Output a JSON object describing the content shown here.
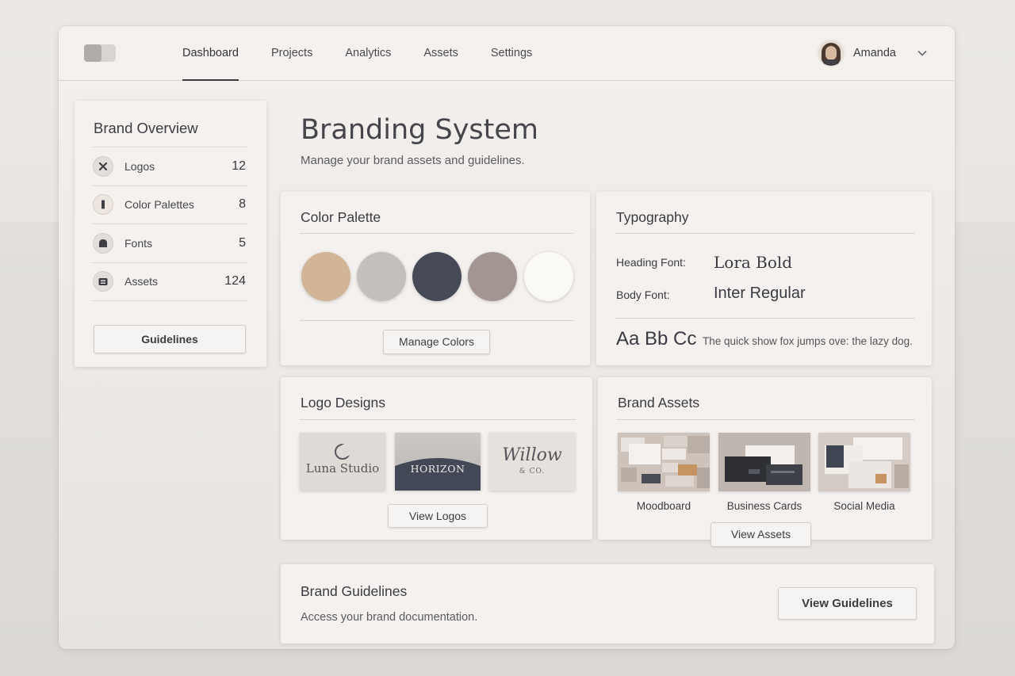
{
  "nav": {
    "tabs": [
      {
        "label": "Dashboard"
      },
      {
        "label": "Projects"
      },
      {
        "label": "Analytics"
      },
      {
        "label": "Assets"
      },
      {
        "label": "Settings"
      }
    ],
    "active_tab": "Dashboard",
    "user_name": "Amanda"
  },
  "sidebar": {
    "title": "Brand Overview",
    "items": [
      {
        "label": "Logos",
        "count": "12",
        "icon": "logo-icon"
      },
      {
        "label": "Color Palettes",
        "count": "8",
        "icon": "palette-icon"
      },
      {
        "label": "Fonts",
        "count": "5",
        "icon": "font-icon"
      },
      {
        "label": "Assets",
        "count": "124",
        "icon": "assets-icon"
      }
    ],
    "button_label": "Guidelines"
  },
  "page": {
    "title": "Branding System",
    "subtitle": "Manage your brand assets and guidelines."
  },
  "palette": {
    "title": "Color Palette",
    "colors": [
      "#d1b596",
      "#c5bfbc",
      "#464a56",
      "#a29592",
      "#fbf9f6"
    ],
    "button_label": "Manage Colors"
  },
  "typography": {
    "title": "Typography",
    "heading_label": "Heading Font:",
    "heading_value": "Lora Bold",
    "body_label": "Body Font:",
    "body_value": "Inter Regular",
    "sample_large": "Aa Bb Cc",
    "sample_text": "The quick show fox jumps ove: the lazy dog."
  },
  "logos": {
    "title": "Logo Designs",
    "items": [
      {
        "name": "Luna Studio"
      },
      {
        "name": "HORIZON"
      },
      {
        "name": "Willow",
        "sub": "& CO."
      }
    ],
    "button_label": "View Logos"
  },
  "assets": {
    "title": "Brand Assets",
    "items": [
      {
        "label": "Moodboard"
      },
      {
        "label": "Business Cards"
      },
      {
        "label": "Social Media"
      }
    ],
    "button_label": "View Assets"
  },
  "guidelines": {
    "title": "Brand Guidelines",
    "subtitle": "Access your brand documentation.",
    "button_label": "View Guidelines"
  }
}
